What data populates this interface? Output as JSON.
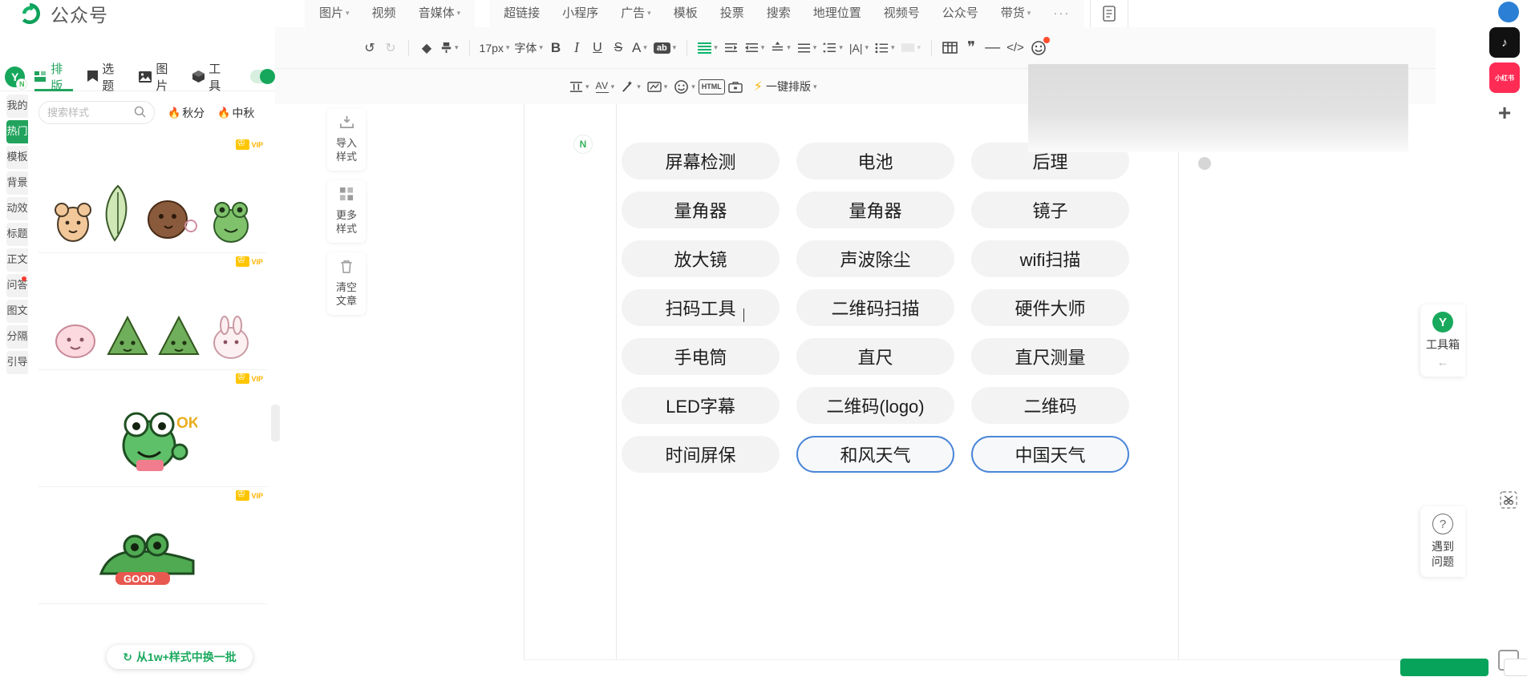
{
  "mp_bar": {
    "brand": "公众号",
    "groups": [
      {
        "items": [
          {
            "label": "图片",
            "caret": true
          },
          {
            "label": "视频",
            "caret": false
          },
          {
            "label": "音媒体",
            "caret": true
          }
        ]
      },
      {
        "items": [
          {
            "label": "超链接",
            "caret": false
          },
          {
            "label": "小程序",
            "caret": false
          },
          {
            "label": "广告",
            "caret": true
          },
          {
            "label": "模板",
            "caret": false
          },
          {
            "label": "投票",
            "caret": false
          },
          {
            "label": "搜索",
            "caret": false
          },
          {
            "label": "地理位置",
            "caret": false
          },
          {
            "label": "视频号",
            "caret": false
          },
          {
            "label": "公众号",
            "caret": false
          },
          {
            "label": "带货",
            "caret": true
          },
          {
            "label": "···",
            "caret": false
          }
        ]
      }
    ]
  },
  "toolbar_row1": {
    "undo": "↺",
    "redo": "↻",
    "eraser": "◆",
    "format_brush": "🖌",
    "font_size": "17px",
    "font_family": "字体",
    "bold": "B",
    "italic": "I",
    "underline": "U",
    "strikethrough": "S",
    "text_color": "A",
    "highlight": "ab",
    "align_color": "≡",
    "indent_increase": "⇥≡",
    "indent_decrease": "≡⇤",
    "line_height": "≑",
    "align_justify": "≡",
    "paragraph_spacing": "⇅≡",
    "letter_spacing": "|A|",
    "bullet_list": "☰",
    "ordered_list": "▭",
    "table": "⊞",
    "quote": "❞",
    "divider": "—",
    "code": "</>",
    "emoji": "☺"
  },
  "toolbar_row2": {
    "layout_icon": "⫯",
    "av_icon": "AV",
    "magic_icon": "✧",
    "chart_icon": "◱",
    "emoji_icon": "☺",
    "html_icon": "HTML",
    "toolbox_icon": "🧰",
    "quick_format": "一键排版"
  },
  "plugin_header": {
    "logo_letter": "Y",
    "logo_sub": "N",
    "tabs": [
      {
        "label": "排版",
        "icon": "layout-icon",
        "active": true
      },
      {
        "label": "选题",
        "icon": "bookmark-icon",
        "active": false
      },
      {
        "label": "图片",
        "icon": "picture-icon",
        "active": false
      },
      {
        "label": "工具",
        "icon": "cube-icon",
        "active": false
      }
    ]
  },
  "category_rail": [
    {
      "label": "我的",
      "active": false,
      "dot": false
    },
    {
      "label": "热门",
      "active": true,
      "dot": false
    },
    {
      "label": "模板",
      "active": false,
      "dot": false
    },
    {
      "label": "背景",
      "active": false,
      "dot": false
    },
    {
      "label": "动效",
      "active": false,
      "dot": false
    },
    {
      "label": "标题",
      "active": false,
      "dot": false
    },
    {
      "label": "正文",
      "active": false,
      "dot": false
    },
    {
      "label": "问答",
      "active": false,
      "dot": true
    },
    {
      "label": "图文",
      "active": false,
      "dot": false
    },
    {
      "label": "分隔",
      "active": false,
      "dot": false
    },
    {
      "label": "引导",
      "active": false,
      "dot": false
    }
  ],
  "search": {
    "placeholder": "搜索样式",
    "value": "",
    "icon": "search-icon"
  },
  "hot_tags": [
    {
      "label": "秋分"
    },
    {
      "label": "中秋"
    }
  ],
  "style_cards": [
    {
      "vip": "VIP"
    },
    {
      "vip": "VIP"
    },
    {
      "vip": "VIP"
    },
    {
      "vip": "VIP"
    }
  ],
  "refresh_button": {
    "label": "从1w+样式中换一批",
    "icon": "refresh-icon"
  },
  "mid_tools": [
    {
      "icon": "import-icon",
      "line1": "导入",
      "line2": "样式"
    },
    {
      "icon": "grid-icon",
      "line1": "更多",
      "line2": "样式"
    },
    {
      "icon": "trash-icon",
      "line1": "清空",
      "line2": "文章"
    }
  ],
  "document": {
    "badge": "N",
    "pills": [
      [
        {
          "label": "屏幕检测",
          "outlined": false
        },
        {
          "label": "电池",
          "outlined": false
        },
        {
          "label": "后理",
          "outlined": false
        }
      ],
      [
        {
          "label": "量角器",
          "outlined": false
        },
        {
          "label": "量角器",
          "outlined": false
        },
        {
          "label": "镜子",
          "outlined": false
        }
      ],
      [
        {
          "label": "放大镜",
          "outlined": false
        },
        {
          "label": "声波除尘",
          "outlined": false
        },
        {
          "label": "wifi扫描",
          "outlined": false
        }
      ],
      [
        {
          "label": "扫码工具",
          "outlined": false
        },
        {
          "label": "二维码扫描",
          "outlined": false
        },
        {
          "label": "硬件大师",
          "outlined": false
        }
      ],
      [
        {
          "label": "手电筒",
          "outlined": false
        },
        {
          "label": "直尺",
          "outlined": false
        },
        {
          "label": "直尺测量",
          "outlined": false
        }
      ],
      [
        {
          "label": "LED字幕",
          "outlined": false
        },
        {
          "label": "二维码(logo)",
          "outlined": false
        },
        {
          "label": "二维码",
          "outlined": false
        }
      ],
      [
        {
          "label": "时间屏保",
          "outlined": false
        },
        {
          "label": "和风天气",
          "outlined": true
        },
        {
          "label": "中国天气",
          "outlined": true
        }
      ]
    ]
  },
  "right_rail": {
    "toolbox": {
      "logo": "Y",
      "label": "工具箱",
      "arrow": "←"
    },
    "help": {
      "icon": "?",
      "label": "遇到问题"
    }
  },
  "browser_rail": {
    "tiktok": "♪",
    "red": "小红书",
    "plus": "+",
    "scissors": "✂",
    "capture": "▣"
  }
}
